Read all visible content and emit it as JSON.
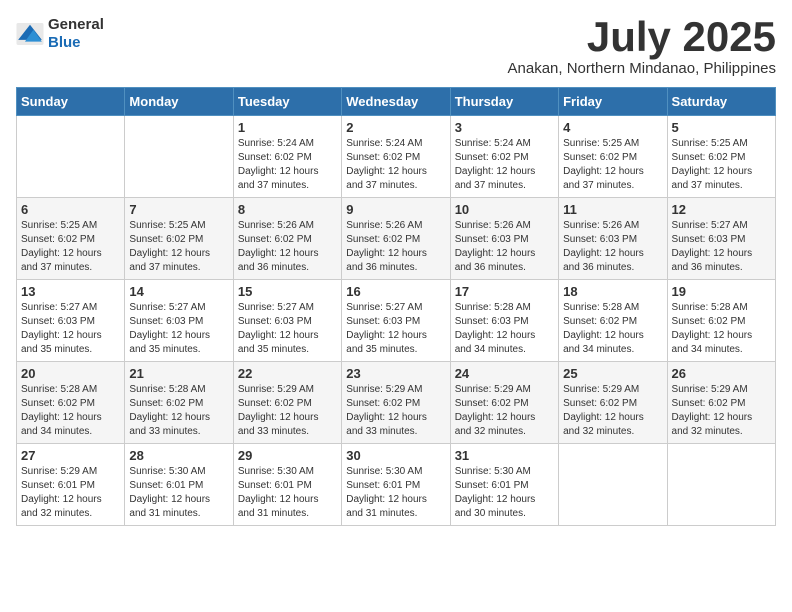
{
  "logo": {
    "general": "General",
    "blue": "Blue"
  },
  "title": {
    "month": "July 2025",
    "location": "Anakan, Northern Mindanao, Philippines"
  },
  "calendar": {
    "headers": [
      "Sunday",
      "Monday",
      "Tuesday",
      "Wednesday",
      "Thursday",
      "Friday",
      "Saturday"
    ],
    "weeks": [
      [
        {
          "day": "",
          "sunrise": "",
          "sunset": "",
          "daylight": ""
        },
        {
          "day": "",
          "sunrise": "",
          "sunset": "",
          "daylight": ""
        },
        {
          "day": "1",
          "sunrise": "Sunrise: 5:24 AM",
          "sunset": "Sunset: 6:02 PM",
          "daylight": "Daylight: 12 hours and 37 minutes."
        },
        {
          "day": "2",
          "sunrise": "Sunrise: 5:24 AM",
          "sunset": "Sunset: 6:02 PM",
          "daylight": "Daylight: 12 hours and 37 minutes."
        },
        {
          "day": "3",
          "sunrise": "Sunrise: 5:24 AM",
          "sunset": "Sunset: 6:02 PM",
          "daylight": "Daylight: 12 hours and 37 minutes."
        },
        {
          "day": "4",
          "sunrise": "Sunrise: 5:25 AM",
          "sunset": "Sunset: 6:02 PM",
          "daylight": "Daylight: 12 hours and 37 minutes."
        },
        {
          "day": "5",
          "sunrise": "Sunrise: 5:25 AM",
          "sunset": "Sunset: 6:02 PM",
          "daylight": "Daylight: 12 hours and 37 minutes."
        }
      ],
      [
        {
          "day": "6",
          "sunrise": "Sunrise: 5:25 AM",
          "sunset": "Sunset: 6:02 PM",
          "daylight": "Daylight: 12 hours and 37 minutes."
        },
        {
          "day": "7",
          "sunrise": "Sunrise: 5:25 AM",
          "sunset": "Sunset: 6:02 PM",
          "daylight": "Daylight: 12 hours and 37 minutes."
        },
        {
          "day": "8",
          "sunrise": "Sunrise: 5:26 AM",
          "sunset": "Sunset: 6:02 PM",
          "daylight": "Daylight: 12 hours and 36 minutes."
        },
        {
          "day": "9",
          "sunrise": "Sunrise: 5:26 AM",
          "sunset": "Sunset: 6:02 PM",
          "daylight": "Daylight: 12 hours and 36 minutes."
        },
        {
          "day": "10",
          "sunrise": "Sunrise: 5:26 AM",
          "sunset": "Sunset: 6:03 PM",
          "daylight": "Daylight: 12 hours and 36 minutes."
        },
        {
          "day": "11",
          "sunrise": "Sunrise: 5:26 AM",
          "sunset": "Sunset: 6:03 PM",
          "daylight": "Daylight: 12 hours and 36 minutes."
        },
        {
          "day": "12",
          "sunrise": "Sunrise: 5:27 AM",
          "sunset": "Sunset: 6:03 PM",
          "daylight": "Daylight: 12 hours and 36 minutes."
        }
      ],
      [
        {
          "day": "13",
          "sunrise": "Sunrise: 5:27 AM",
          "sunset": "Sunset: 6:03 PM",
          "daylight": "Daylight: 12 hours and 35 minutes."
        },
        {
          "day": "14",
          "sunrise": "Sunrise: 5:27 AM",
          "sunset": "Sunset: 6:03 PM",
          "daylight": "Daylight: 12 hours and 35 minutes."
        },
        {
          "day": "15",
          "sunrise": "Sunrise: 5:27 AM",
          "sunset": "Sunset: 6:03 PM",
          "daylight": "Daylight: 12 hours and 35 minutes."
        },
        {
          "day": "16",
          "sunrise": "Sunrise: 5:27 AM",
          "sunset": "Sunset: 6:03 PM",
          "daylight": "Daylight: 12 hours and 35 minutes."
        },
        {
          "day": "17",
          "sunrise": "Sunrise: 5:28 AM",
          "sunset": "Sunset: 6:03 PM",
          "daylight": "Daylight: 12 hours and 34 minutes."
        },
        {
          "day": "18",
          "sunrise": "Sunrise: 5:28 AM",
          "sunset": "Sunset: 6:02 PM",
          "daylight": "Daylight: 12 hours and 34 minutes."
        },
        {
          "day": "19",
          "sunrise": "Sunrise: 5:28 AM",
          "sunset": "Sunset: 6:02 PM",
          "daylight": "Daylight: 12 hours and 34 minutes."
        }
      ],
      [
        {
          "day": "20",
          "sunrise": "Sunrise: 5:28 AM",
          "sunset": "Sunset: 6:02 PM",
          "daylight": "Daylight: 12 hours and 34 minutes."
        },
        {
          "day": "21",
          "sunrise": "Sunrise: 5:28 AM",
          "sunset": "Sunset: 6:02 PM",
          "daylight": "Daylight: 12 hours and 33 minutes."
        },
        {
          "day": "22",
          "sunrise": "Sunrise: 5:29 AM",
          "sunset": "Sunset: 6:02 PM",
          "daylight": "Daylight: 12 hours and 33 minutes."
        },
        {
          "day": "23",
          "sunrise": "Sunrise: 5:29 AM",
          "sunset": "Sunset: 6:02 PM",
          "daylight": "Daylight: 12 hours and 33 minutes."
        },
        {
          "day": "24",
          "sunrise": "Sunrise: 5:29 AM",
          "sunset": "Sunset: 6:02 PM",
          "daylight": "Daylight: 12 hours and 32 minutes."
        },
        {
          "day": "25",
          "sunrise": "Sunrise: 5:29 AM",
          "sunset": "Sunset: 6:02 PM",
          "daylight": "Daylight: 12 hours and 32 minutes."
        },
        {
          "day": "26",
          "sunrise": "Sunrise: 5:29 AM",
          "sunset": "Sunset: 6:02 PM",
          "daylight": "Daylight: 12 hours and 32 minutes."
        }
      ],
      [
        {
          "day": "27",
          "sunrise": "Sunrise: 5:29 AM",
          "sunset": "Sunset: 6:01 PM",
          "daylight": "Daylight: 12 hours and 32 minutes."
        },
        {
          "day": "28",
          "sunrise": "Sunrise: 5:30 AM",
          "sunset": "Sunset: 6:01 PM",
          "daylight": "Daylight: 12 hours and 31 minutes."
        },
        {
          "day": "29",
          "sunrise": "Sunrise: 5:30 AM",
          "sunset": "Sunset: 6:01 PM",
          "daylight": "Daylight: 12 hours and 31 minutes."
        },
        {
          "day": "30",
          "sunrise": "Sunrise: 5:30 AM",
          "sunset": "Sunset: 6:01 PM",
          "daylight": "Daylight: 12 hours and 31 minutes."
        },
        {
          "day": "31",
          "sunrise": "Sunrise: 5:30 AM",
          "sunset": "Sunset: 6:01 PM",
          "daylight": "Daylight: 12 hours and 30 minutes."
        },
        {
          "day": "",
          "sunrise": "",
          "sunset": "",
          "daylight": ""
        },
        {
          "day": "",
          "sunrise": "",
          "sunset": "",
          "daylight": ""
        }
      ]
    ]
  }
}
